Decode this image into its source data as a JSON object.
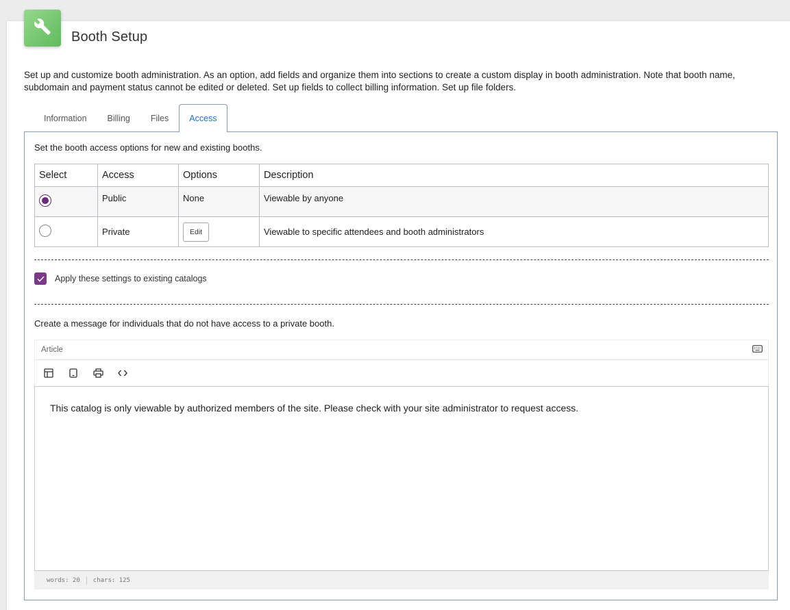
{
  "header": {
    "title": "Booth Setup",
    "app_icon": "wrench-icon",
    "accent": "#6fc568"
  },
  "intro": "Set up and customize booth administration. As an option, add fields and organize them into sections to create a custom display in booth administration. Note that booth name, subdomain and payment status cannot be edited or deleted. Set up fields to collect billing information. Set up file folders.",
  "tabs": [
    {
      "label": "Information"
    },
    {
      "label": "Billing"
    },
    {
      "label": "Files"
    },
    {
      "label": "Access",
      "active": true
    }
  ],
  "access": {
    "lead": "Set the booth access options for new and existing booths.",
    "columns": [
      "Select",
      "Access",
      "Options",
      "Description"
    ],
    "rows": [
      {
        "selected": true,
        "access": "Public",
        "options": "None",
        "description": "Viewable by anyone"
      },
      {
        "selected": false,
        "access": "Private",
        "options_button": "Edit",
        "description": "Viewable to specific attendees and booth administrators"
      }
    ],
    "apply_existing": {
      "checked": true,
      "label": "Apply these settings to existing catalogs"
    },
    "message_lead": "Create a message for individuals that do not have access to a private booth."
  },
  "editor": {
    "label": "Article",
    "tools": [
      "layout-icon",
      "tablet-icon",
      "print-icon",
      "code-icon"
    ],
    "keyboard_icon": "keyboard-icon",
    "content": "This catalog is only viewable by authorized members of the site. Please check with your site administrator to request access.",
    "words": "words: 20",
    "chars": "chars: 125"
  },
  "colors": {
    "radio_selected": "#6a2a7a",
    "checkbox": "#7b3a89",
    "active_tab": "#1f6fd1"
  }
}
